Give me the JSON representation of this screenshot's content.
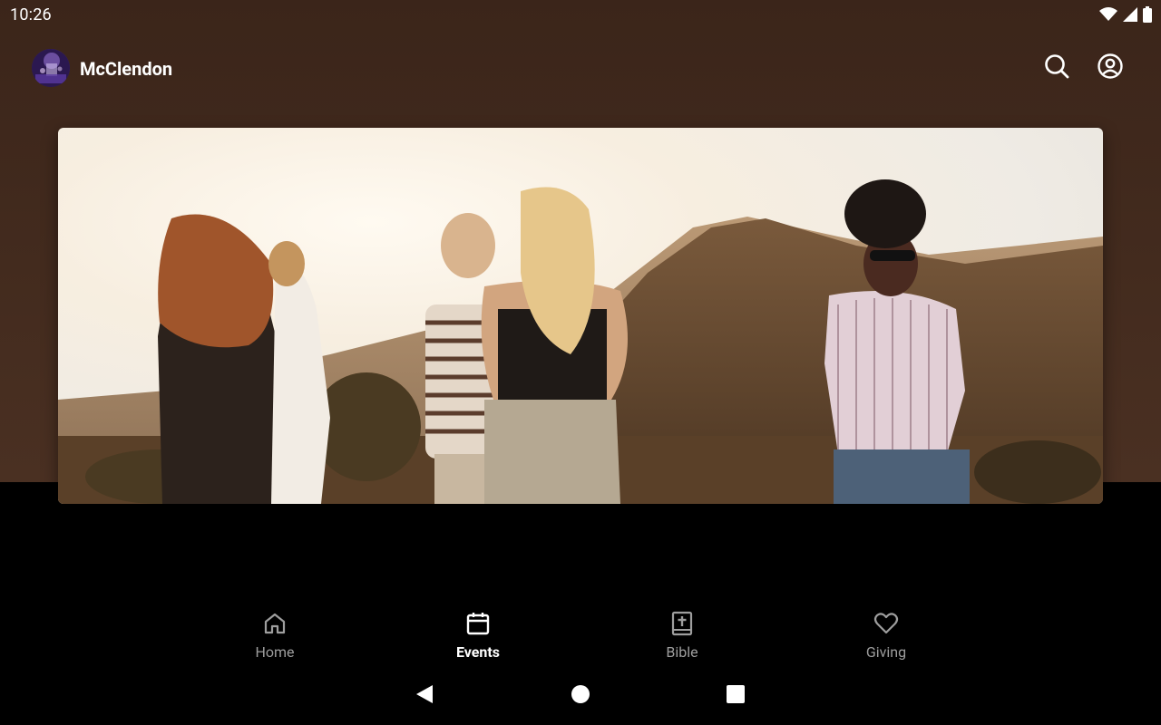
{
  "status_bar": {
    "time": "10:26",
    "icons": [
      "wifi-icon",
      "cellular-signal-icon",
      "battery-icon"
    ]
  },
  "app_bar": {
    "org_name": "McClendon",
    "avatar": "church-logo-avatar",
    "actions": [
      "search-icon",
      "account-circle-icon"
    ]
  },
  "hero": {
    "image": "group of friends standing outdoors at sunset with hills behind"
  },
  "bottom_nav": {
    "items": [
      {
        "label": "Home",
        "icon": "home-icon",
        "active": false
      },
      {
        "label": "Events",
        "icon": "calendar-icon",
        "active": true
      },
      {
        "label": "Bible",
        "icon": "bible-icon",
        "active": false
      },
      {
        "label": "Giving",
        "icon": "heart-icon",
        "active": false
      }
    ]
  },
  "system_nav": [
    "back-icon",
    "home-circle-icon",
    "recents-icon"
  ],
  "colors": {
    "header_bg": "#3f281c",
    "body_bg": "#000000",
    "active": "#ffffff",
    "inactive": "#9e9e9e"
  }
}
